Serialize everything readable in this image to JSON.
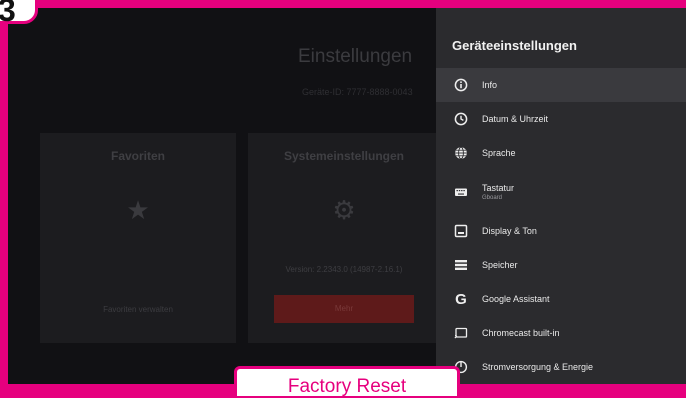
{
  "step": {
    "number": "3"
  },
  "background": {
    "title": "Einstellungen",
    "device_id": "Geräte-ID: 7777-8888-0043",
    "cards": [
      {
        "title": "Favoriten",
        "icon": "star-icon",
        "link": "Favoriten verwalten"
      },
      {
        "title": "Systemeinstellungen",
        "icon": "gear-icon",
        "version": "Version: 2.2343.0 (14987-2.16.1)",
        "button": "Mehr"
      }
    ]
  },
  "panel": {
    "title": "Geräteeinstellungen",
    "items": [
      {
        "label": "Info",
        "icon": "info-icon",
        "selected": true
      },
      {
        "label": "Datum & Uhrzeit",
        "icon": "clock-icon"
      },
      {
        "label": "Sprache",
        "icon": "globe-icon"
      },
      {
        "label": "Tastatur",
        "sub": "Gboard",
        "icon": "keyboard-icon"
      },
      {
        "label": "Display & Ton",
        "icon": "display-icon"
      },
      {
        "label": "Speicher",
        "icon": "storage-icon"
      },
      {
        "label": "Google Assistant",
        "icon": "google-icon"
      },
      {
        "label": "Chromecast built-in",
        "icon": "cast-icon"
      },
      {
        "label": "Stromversorgung & Energie",
        "icon": "power-icon"
      }
    ]
  },
  "caption": {
    "text": "Factory Reset"
  },
  "colors": {
    "accent": "#e6007e",
    "panel": "#2b2b2e",
    "screen": "#111114"
  }
}
